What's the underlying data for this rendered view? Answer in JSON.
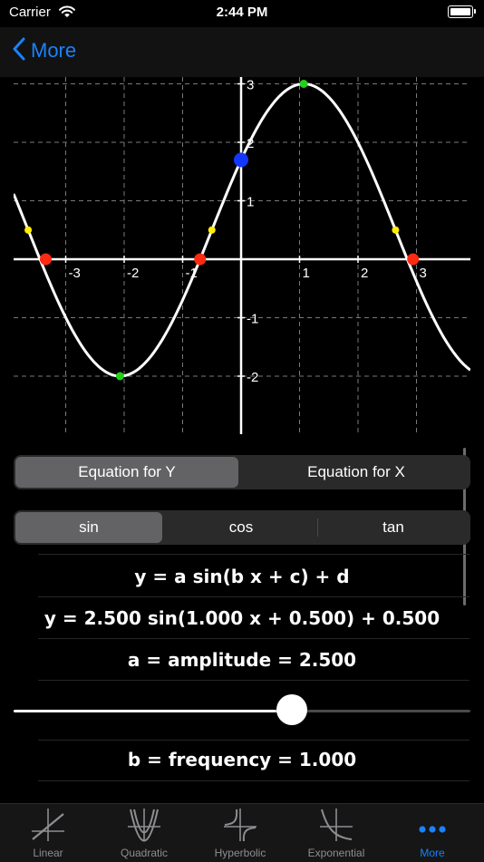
{
  "status": {
    "carrier": "Carrier",
    "time": "2:44 PM"
  },
  "nav": {
    "back_label": "More"
  },
  "chart_data": {
    "type": "line",
    "equation": {
      "a": 2.5,
      "b": 1.0,
      "c": 0.5,
      "d": 0.5,
      "fn": "sin"
    },
    "xlim": [
      -3.9,
      3.9
    ],
    "ylim": [
      -2.9,
      3.0
    ],
    "x_ticks": [
      "-3",
      "-2",
      "-1",
      "1",
      "2",
      "3"
    ],
    "y_ticks": [
      "3",
      "2",
      "1",
      "-1",
      "-2"
    ],
    "grid": true,
    "special_points": {
      "y_intercept": [
        [
          0.0,
          1.699
        ]
      ],
      "zeros": [
        [
          -3.342,
          0.0
        ],
        [
          -0.702,
          0.0
        ],
        [
          2.941,
          0.0
        ]
      ],
      "extrema": [
        [
          -2.071,
          -2.0
        ],
        [
          1.071,
          3.0
        ]
      ],
      "midline_points": [
        [
          -3.642,
          0.5
        ],
        [
          -0.5,
          0.5
        ],
        [
          2.642,
          0.5
        ]
      ]
    },
    "colors": {
      "curve": "#ffffff",
      "y_intercept": "#1437ff",
      "zeros": "#ff2a12",
      "extrema": "#22d11a",
      "midline": "#ffee00",
      "grid": "#7a7a7a",
      "axis": "#ffffff"
    }
  },
  "controls": {
    "equation_tabs": [
      "Equation for Y",
      "Equation for X"
    ],
    "equation_selected": 0,
    "function_tabs": [
      "sin",
      "cos",
      "tan"
    ],
    "function_selected": 0
  },
  "formulas": {
    "general": "y = a sin(b x + c) + d",
    "current": "y = 2.500 sin(1.000 x + 0.500) + 0.500",
    "amplitude": "a = amplitude = 2.500",
    "frequency": "b = frequency = 1.000"
  },
  "slider": {
    "value": 0.61
  },
  "tabbar": {
    "items": [
      {
        "label": "Linear",
        "icon": "linear-graph-icon"
      },
      {
        "label": "Quadratic",
        "icon": "quadratic-graph-icon"
      },
      {
        "label": "Hyperbolic",
        "icon": "hyperbolic-graph-icon"
      },
      {
        "label": "Exponential",
        "icon": "exponential-graph-icon"
      },
      {
        "label": "More",
        "icon": "more-dots-icon"
      }
    ],
    "active": 4,
    "accent": "#1a82fb"
  }
}
